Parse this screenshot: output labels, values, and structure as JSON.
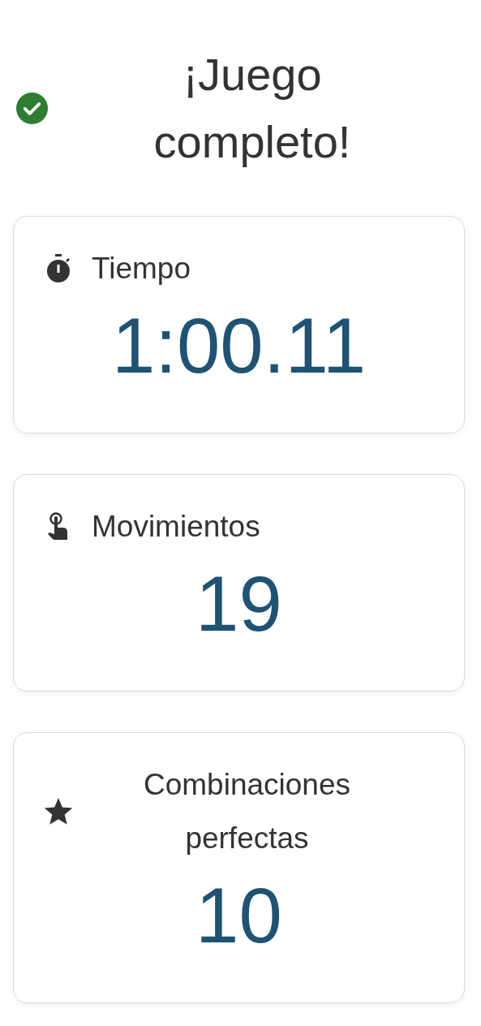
{
  "header": {
    "title": "¡Juego completo!",
    "completed": true
  },
  "stats": [
    {
      "kind": "time",
      "label": "Tiempo",
      "value": "1:00.11"
    },
    {
      "kind": "moves",
      "label": "Movimientos",
      "value": "19"
    },
    {
      "kind": "matches",
      "label": "Combinaciones perfectas",
      "value": "10"
    }
  ]
}
